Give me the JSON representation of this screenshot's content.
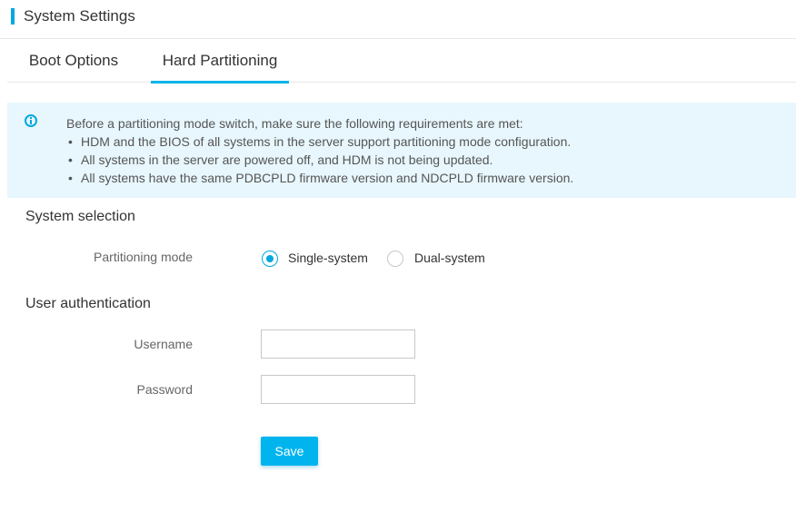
{
  "header": {
    "title": "System Settings"
  },
  "tabs": [
    {
      "label": "Boot Options",
      "active": false
    },
    {
      "label": "Hard Partitioning",
      "active": true
    }
  ],
  "info": {
    "intro": "Before a partitioning mode switch, make sure the following requirements are met:",
    "items": [
      "HDM and the BIOS of all systems in the server support partitioning mode configuration.",
      "All systems in the server are powered off, and HDM is not being updated.",
      "All systems have the same PDBCPLD firmware version and NDCPLD firmware version."
    ]
  },
  "system_selection": {
    "title": "System selection",
    "mode_label": "Partitioning mode",
    "options": [
      {
        "label": "Single-system",
        "checked": true
      },
      {
        "label": "Dual-system",
        "checked": false
      }
    ]
  },
  "user_auth": {
    "title": "User authentication",
    "username_label": "Username",
    "username_value": "",
    "password_label": "Password",
    "password_value": ""
  },
  "actions": {
    "save_label": "Save"
  },
  "colors": {
    "accent": "#00a8e0",
    "info_bg": "#e8f7fd",
    "button": "#00b4ee"
  },
  "icons": {
    "info": "info-icon"
  }
}
